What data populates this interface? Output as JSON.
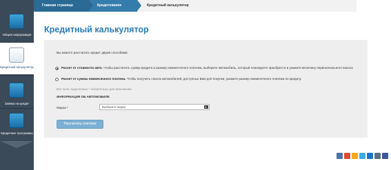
{
  "sidebar": {
    "items": [
      {
        "label": "Общая информация",
        "icon": "info-icon",
        "active": false
      },
      {
        "label": "Кредитный калькулятор",
        "icon": "calculator-icon",
        "active": true
      },
      {
        "label": "Заявка на кредит",
        "icon": "application-icon",
        "active": false
      },
      {
        "label": "Кредитные программы",
        "icon": "document-icon",
        "active": false
      }
    ]
  },
  "breadcrumbs": [
    "Главная страница",
    "Кредитование",
    "Кредитный калькулятор"
  ],
  "page": {
    "title": "Кредитный калькулятор"
  },
  "panel": {
    "intro": "Вы можете рассчитать кредит двумя способами:",
    "option1_bold": "Расчет от стоимости авто.",
    "option1_text": " Чтобы рассчитать сумму кредита и размер ежемесячного платежа, выберите автомобиль, который планируете приобрести и укажите величину первоначального взноса",
    "option2_bold": "Расчет от суммы ежемесячного платежа.",
    "option2_text": " Чтобы получить список автомобилей, доступных Вам для покупки, укажите размер ежемесячного платежа по кредиту.",
    "required_note": "Все поля, выделенные * обязательны для заполнения",
    "section_title": "ИНФОРМАЦИЯ ОБ АВТОМОБИЛЕ",
    "brand_label": "Марка *",
    "brand_value": "Выберите марку",
    "calc_button": "Рассчитать платежи"
  },
  "social": [
    "vk",
    "google",
    "mail",
    "twitter",
    "livejournal",
    "odnoklassniki",
    "facebook"
  ],
  "colors": {
    "accent": "#2a7bb3",
    "sidebar": "#3b4a58",
    "button": "#7cb0d2"
  }
}
